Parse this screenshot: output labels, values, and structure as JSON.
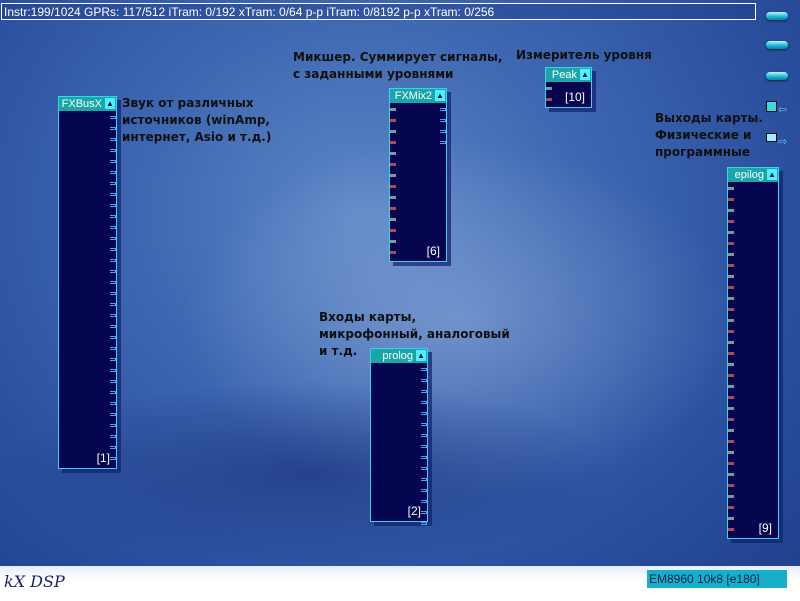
{
  "status_bar": "Instr:199/1024 GPRs: 117/512 iTram: 0/192 xTram: 0/64 p-p iTram: 0/8192 p-p xTram: 0/256",
  "toolbar": {
    "buttons": [
      "menu-button-1",
      "menu-button-2",
      "menu-button-3"
    ],
    "save_icon": "floppy-arrow-icon",
    "open_icon": "folder-arrow-icon"
  },
  "blocks": [
    {
      "name": "FXBusX",
      "id": "[1]",
      "inputs": 0,
      "outputs": 32
    },
    {
      "name": "FXMix2",
      "id": "[6]",
      "inputs": 14,
      "outputs": 4
    },
    {
      "name": "Peak",
      "id": "[10]",
      "inputs": 2,
      "outputs": 0
    },
    {
      "name": "prolog",
      "id": "[2]",
      "inputs": 0,
      "outputs": 15
    },
    {
      "name": "epilog",
      "id": "[9]",
      "inputs": 32,
      "outputs": 0
    }
  ],
  "annotations": {
    "fxbusx": "Звук от различных источников (winAmp, интернет, Asio и т.д.)",
    "fxmix": "Микшер. Суммирует сигналы, с заданными уровнями",
    "peak": "Измеритель уровня",
    "epilog": "Выходы карты. Физические и программные",
    "prolog": "Входы карты, микрофонный, аналоговый и т.д."
  },
  "footer": {
    "logo": "kX DSP",
    "device": "EM8960 10k8 [e180]"
  }
}
